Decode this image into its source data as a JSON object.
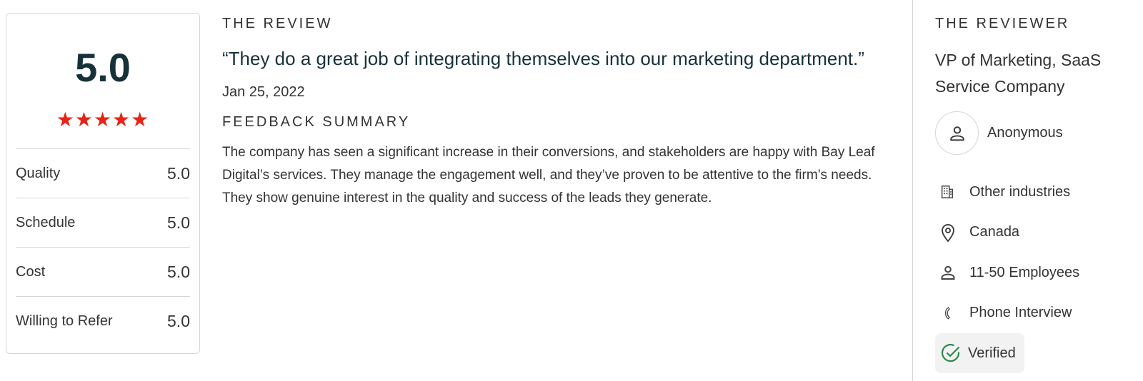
{
  "rating": {
    "overall": "5.0",
    "stars": "★★★★★",
    "star_color": "#e62415",
    "scores": [
      {
        "label": "Quality",
        "value": "5.0"
      },
      {
        "label": "Schedule",
        "value": "5.0"
      },
      {
        "label": "Cost",
        "value": "5.0"
      },
      {
        "label": "Willing to Refer",
        "value": "5.0"
      }
    ]
  },
  "review": {
    "heading": "THE REVIEW",
    "quote": "“They do a great job of integrating themselves into our marketing department.”",
    "date": "Jan 25, 2022",
    "feedback_heading": "FEEDBACK SUMMARY",
    "summary": "The company has seen a significant increase in their conversions, and stakeholders are happy with Bay Leaf Digital’s services. They manage the engagement well, and they’ve proven to be attentive to the firm’s needs. They show genuine interest in the quality and success of the leads they generate."
  },
  "reviewer": {
    "heading": "THE REVIEWER",
    "title": "VP of Marketing, SaaS Service Company",
    "name": "Anonymous",
    "avatar_icon": "user-icon",
    "details": [
      {
        "icon": "building-icon",
        "text": "Other industries"
      },
      {
        "icon": "location-pin-icon",
        "text": "Canada"
      },
      {
        "icon": "person-icon",
        "text": "11-50 Employees"
      },
      {
        "icon": "phone-icon",
        "text": "Phone Interview"
      }
    ],
    "verified": "Verified",
    "verified_color": "#2a8a4a"
  }
}
